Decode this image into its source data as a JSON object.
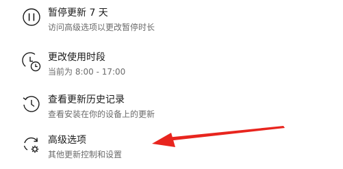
{
  "options": [
    {
      "title": "暂停更新 7 天",
      "desc": "访问高级选项以更改暂停时长",
      "icon": "pause-icon"
    },
    {
      "title": "更改使用时段",
      "desc": "当前为 8:00 - 17:00",
      "icon": "clock-schedule-icon"
    },
    {
      "title": "查看更新历史记录",
      "desc": "查看安装在你的设备上的更新",
      "icon": "history-icon"
    },
    {
      "title": "高级选项",
      "desc": "其他更新控制和设置",
      "icon": "advanced-settings-icon"
    }
  ],
  "annotation": {
    "color": "#e8251e",
    "icon": "red-arrow"
  }
}
